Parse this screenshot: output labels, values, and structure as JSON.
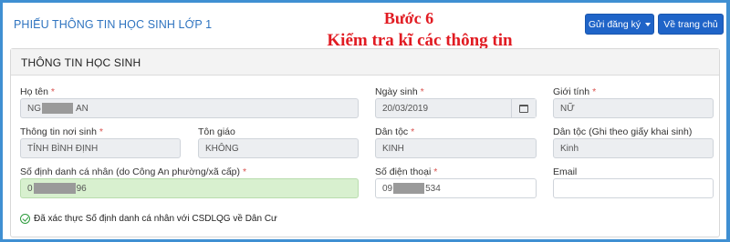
{
  "header": {
    "page_title": "PHIẾU THÔNG TIN HỌC SINH LỚP 1",
    "step_line1": "Bước 6",
    "step_line2": "Kiểm tra kĩ các thông tin",
    "register_button": "Gửi đăng ký",
    "home_button": "Về trang chủ"
  },
  "section": {
    "title": "THÔNG TIN HỌC SINH"
  },
  "fields": {
    "full_name": {
      "label": "Họ tên",
      "value_start": "NG",
      "value_end": "AN"
    },
    "birth_date": {
      "label": "Ngày sinh",
      "value": "20/03/2019"
    },
    "gender": {
      "label": "Giới tính",
      "value": "NỮ"
    },
    "birth_place": {
      "label": "Thông tin nơi sinh",
      "value": "TỈNH BÌNH ĐỊNH"
    },
    "religion": {
      "label": "Tôn giáo",
      "value": "KHÔNG"
    },
    "ethnicity": {
      "label": "Dân tộc",
      "value": "KINH"
    },
    "ethnicity_birth_cert": {
      "label": "Dân tộc (Ghi theo giấy khai sinh)",
      "value": "Kinh"
    },
    "personal_id": {
      "label": "Số định danh cá nhân (do Công An phường/xã cấp)",
      "value_start": "0",
      "value_end": "96"
    },
    "phone": {
      "label": "Số điện thoại",
      "value_start": "09",
      "value_end": "534"
    },
    "email": {
      "label": "Email",
      "value": ""
    }
  },
  "required_marker": "*",
  "verified_text": "Đã xác thực Số định danh cá nhân với CSDLQG về Dân Cư",
  "colors": {
    "accent": "#1f64c8",
    "title_blue": "#2f74c0",
    "step_red": "#e11b22",
    "verified_green": "#d8f0cf"
  }
}
